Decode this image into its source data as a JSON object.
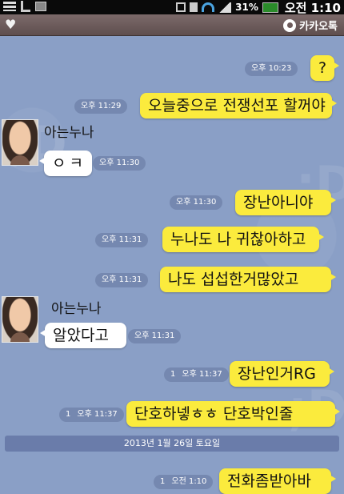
{
  "status_bar": {
    "battery": "31%",
    "time": "오전 1:10"
  },
  "title_bar": {
    "brand": "카카오톡"
  },
  "date_divider": "2013년 1월 26일 토요일",
  "contact": {
    "name": "아는누나"
  },
  "messages": [
    {
      "side": "right",
      "text": "?",
      "time": "오후 10:23",
      "unread": ""
    },
    {
      "side": "right",
      "text": "오늘중으로 전쟁선포 할꺼야",
      "time": "오후 11:29",
      "unread": ""
    },
    {
      "side": "left",
      "text": "ㅇㅋ",
      "time": "오후 11:30",
      "sender": "아는누나"
    },
    {
      "side": "right",
      "text": "장난아니야",
      "time": "오후 11:30",
      "unread": ""
    },
    {
      "side": "right",
      "text": "누나도 나 귀찮아하고",
      "time": "오후 11:31",
      "unread": ""
    },
    {
      "side": "right",
      "text": "나도 섭섭한거많았고",
      "time": "오후 11:31",
      "unread": ""
    },
    {
      "side": "left",
      "text": "알았다고",
      "time": "오후 11:31",
      "sender": "아는누나"
    },
    {
      "side": "right",
      "text": "장난인거RG",
      "time": "오후 11:37",
      "unread": "1"
    },
    {
      "side": "right",
      "text": "단호하넿ㅎㅎ 단호박인줄",
      "time": "오후 11:37",
      "unread": "1"
    },
    {
      "side": "right",
      "text": "전화좀받아바",
      "time": "오전 1:10",
      "unread": "1"
    }
  ]
}
